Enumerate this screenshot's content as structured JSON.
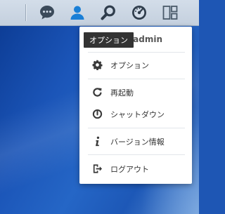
{
  "menu": {
    "username": "admin",
    "items": [
      {
        "label": "オプション",
        "icon": "gear-icon"
      },
      {
        "label": "再起動",
        "icon": "restart-icon"
      },
      {
        "label": "シャットダウン",
        "icon": "power-icon"
      },
      {
        "label": "バージョン情報",
        "icon": "info-icon"
      },
      {
        "label": "ログアウト",
        "icon": "logout-icon"
      }
    ]
  },
  "tooltip": {
    "text": "オプション"
  },
  "taskbar": {
    "icons": [
      "chat-icon",
      "user-icon",
      "search-icon",
      "dashboard-gauge-icon",
      "widgets-icon"
    ],
    "active_color": "#1a7fd6",
    "icon_color": "#3a4a5a"
  }
}
